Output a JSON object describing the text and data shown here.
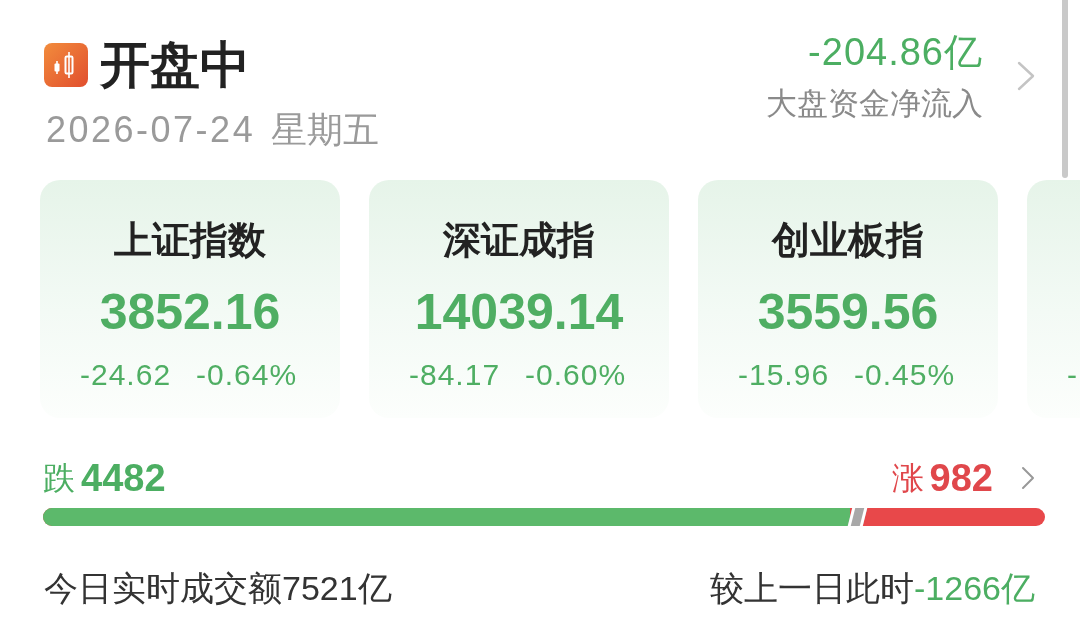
{
  "header": {
    "title": "开盘中",
    "date": "2026-07-24",
    "weekday": "星期五"
  },
  "net_inflow": {
    "value": "-204.86亿",
    "label": "大盘资金净流入"
  },
  "index_cards": [
    {
      "name": "上证指数",
      "value": "3852.16",
      "change": "-24.62",
      "change_percent": "-0.64%"
    },
    {
      "name": "深证成指",
      "value": "14039.14",
      "change": "-84.17",
      "change_percent": "-0.60%"
    },
    {
      "name": "创业板指",
      "value": "3559.56",
      "change": "-15.96",
      "change_percent": "-0.45%"
    },
    {
      "change": "-"
    }
  ],
  "breadth": {
    "down_label": "跌",
    "down_count": "4482",
    "up_label": "涨",
    "up_count": "982",
    "ratio_bar": {
      "level": 0.805
    }
  },
  "turnover": {
    "text": "今日实时成交额7521亿",
    "compare_label": "较上一日此时",
    "compare_value": "-1266亿"
  }
}
